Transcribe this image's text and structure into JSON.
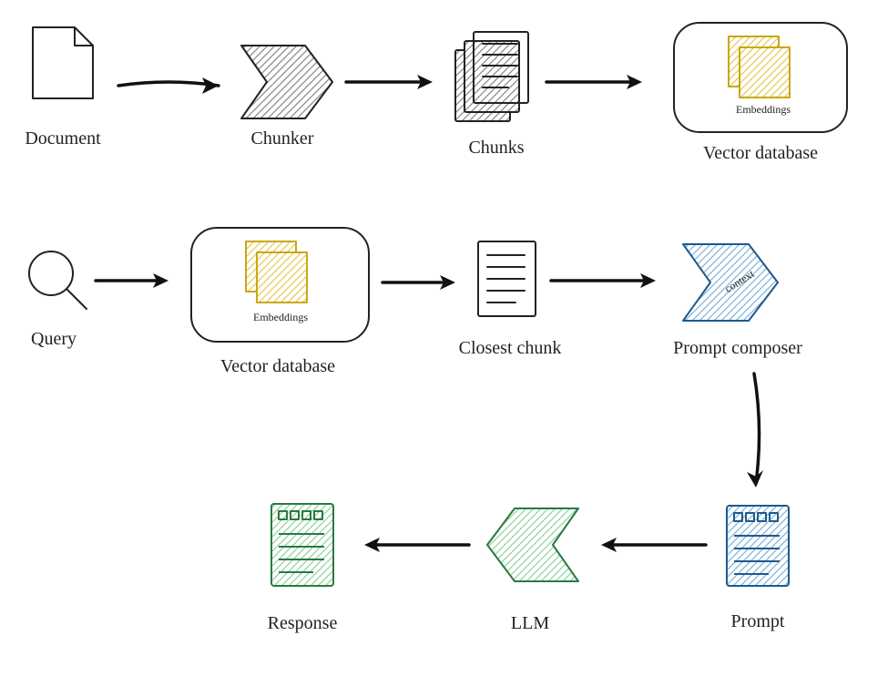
{
  "diagram": {
    "type": "flow",
    "nodes": {
      "document": "Document",
      "chunker": "Chunker",
      "chunks": "Chunks",
      "vector_db_1": "Vector database",
      "embeddings_1": "Embeddings",
      "query": "Query",
      "vector_db_2": "Vector database",
      "embeddings_2": "Embeddings",
      "closest_chunk": "Closest chunk",
      "prompt_composer": "Prompt composer",
      "context": "context",
      "prompt": "Prompt",
      "llm": "LLM",
      "response": "Response"
    },
    "flows": [
      [
        "document",
        "chunker",
        "chunks",
        "vector_db_1"
      ],
      [
        "query",
        "vector_db_2",
        "closest_chunk",
        "prompt_composer",
        "prompt",
        "llm",
        "response"
      ]
    ]
  }
}
